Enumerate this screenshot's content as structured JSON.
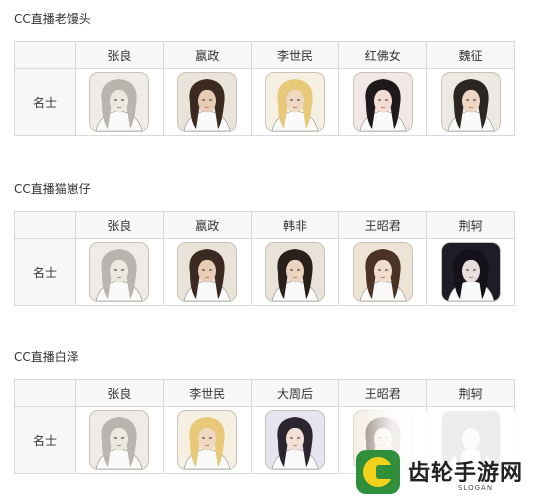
{
  "sections": [
    {
      "title": "CC直播老馒头",
      "row_label": "名士",
      "heroes": [
        {
          "name": "张良",
          "skin": "#ebe7e1",
          "hair": "#b9b4ad",
          "bg": "#efece8"
        },
        {
          "name": "嬴政",
          "skin": "#e8cdb6",
          "hair": "#3b2a22",
          "bg": "#eae3da"
        },
        {
          "name": "李世民",
          "skin": "#f0d9c2",
          "hair": "#e8c97a",
          "bg": "#f6f0e2"
        },
        {
          "name": "红佛女",
          "skin": "#f3ddd3",
          "hair": "#1e1a1c",
          "bg": "#f1e7e4"
        },
        {
          "name": "魏征",
          "skin": "#eed6c2",
          "hair": "#2a2622",
          "bg": "#ece8e2"
        }
      ]
    },
    {
      "title": "CC直播猫崽仔",
      "row_label": "名士",
      "heroes": [
        {
          "name": "张良",
          "skin": "#ebe7e1",
          "hair": "#b9b4ad",
          "bg": "#efece8"
        },
        {
          "name": "嬴政",
          "skin": "#e8cdb6",
          "hair": "#3b2a22",
          "bg": "#eae3da"
        },
        {
          "name": "韩非",
          "skin": "#ecd3bf",
          "hair": "#2a201b",
          "bg": "#e9e2d9"
        },
        {
          "name": "王昭君",
          "skin": "#f2dccb",
          "hair": "#4a3225",
          "bg": "#eee4d6"
        },
        {
          "name": "荆轲",
          "skin": "#e8dede",
          "hair": "#141218",
          "bg": "#1e1c24"
        }
      ]
    },
    {
      "title": "CC直播白泽",
      "row_label": "名士",
      "heroes": [
        {
          "name": "张良",
          "skin": "#ebe7e1",
          "hair": "#b9b4ad",
          "bg": "#efece8"
        },
        {
          "name": "李世民",
          "skin": "#f0d9c2",
          "hair": "#e8c97a",
          "bg": "#f6f0e2"
        },
        {
          "name": "大周后",
          "skin": "#f3e0d6",
          "hair": "#2b2530",
          "bg": "#e6e4ee"
        },
        {
          "name": "王昭君",
          "skin": "#f2dccb",
          "hair": "#4a3225",
          "bg": "#eee4d6"
        },
        {
          "name": "荆轲",
          "skin": "#e8dede",
          "hair": "#141218",
          "bg": "#1e1c24"
        }
      ]
    }
  ],
  "watermark": {
    "name": "齿轮手游网",
    "slogan": "SLOGAN",
    "logo_color": "#2f8f3a",
    "logo_accent": "#f2d21b"
  }
}
